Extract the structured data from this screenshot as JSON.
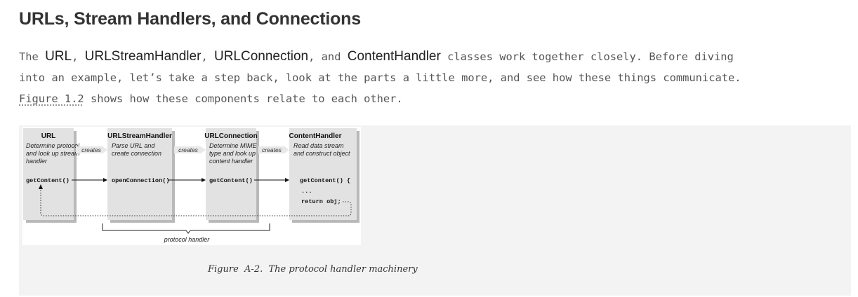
{
  "section": {
    "title": "URLs, Stream Handlers, and Connections"
  },
  "paragraph": {
    "t1": "The ",
    "c1": "URL",
    "t2": ", ",
    "c2": "URLStreamHandler",
    "t3": ", ",
    "c3": "URLConnection",
    "t4": ", and ",
    "c4": "ContentHandler",
    "t5": " classes work together closely. Before diving",
    "line2": "into an example, let’s take a step back, look at the parts a little more, and see how these things communicate.",
    "link": "Figure 1.2",
    "t6": " shows how these components relate to each other."
  },
  "figure": {
    "caption": "Figure  A-2.  The protocol handler machinery",
    "boxes": [
      {
        "title": "URL",
        "desc": [
          "Determine protocol",
          "and look up stream",
          "handler"
        ],
        "code": "getContent()"
      },
      {
        "title": "URLStreamHandler",
        "desc": [
          "Parse URL and",
          "create connection"
        ],
        "code": "openConnection()"
      },
      {
        "title": "URLConnection",
        "desc": [
          "Determine MIME",
          "type and look up",
          "content handler"
        ],
        "code": "getContent()"
      },
      {
        "title": "ContentHandler",
        "desc": [
          "Read data stream",
          "and construct object"
        ],
        "code": "getContent() {"
      }
    ],
    "code_extra": [
      "...",
      "return obj;"
    ],
    "creates_label": "creates",
    "brace_label": "protocol handler"
  }
}
